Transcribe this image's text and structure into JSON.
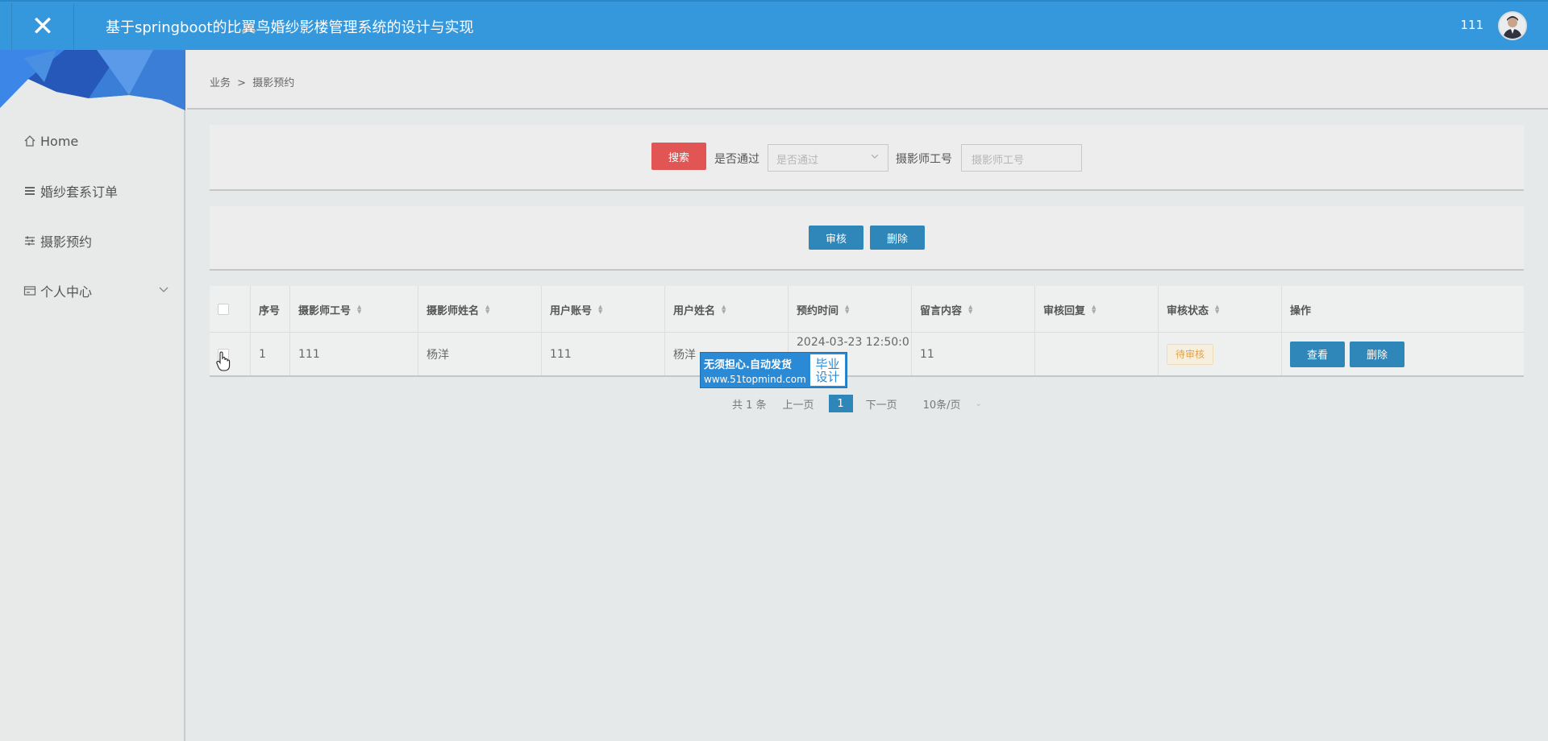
{
  "header": {
    "close_glyph": "✕",
    "title": "基于springboot的比翼鸟婚纱影楼管理系统的设计与实现",
    "username": "111"
  },
  "sidebar": {
    "items": [
      {
        "label": "Home",
        "icon": "home-icon"
      },
      {
        "label": "婚纱套系订单",
        "icon": "list-icon"
      },
      {
        "label": "摄影预约",
        "icon": "sliders-icon"
      },
      {
        "label": "个人中心",
        "icon": "card-icon"
      }
    ]
  },
  "breadcrumb": {
    "parent": "业务",
    "separator": ">",
    "current": "摄影预约"
  },
  "search": {
    "button_label": "搜索",
    "approved_label": "是否通过",
    "approved_placeholder": "是否通过",
    "photographer_id_label": "摄影师工号",
    "photographer_id_placeholder": "摄影师工号"
  },
  "actions": {
    "audit_label": "审核",
    "delete_label": "删除"
  },
  "table": {
    "columns": [
      "序号",
      "摄影师工号",
      "摄影师姓名",
      "用户账号",
      "用户姓名",
      "预约时间",
      "留言内容",
      "审核回复",
      "审核状态",
      "操作"
    ],
    "rows": [
      {
        "index": "1",
        "photographer_id": "111",
        "photographer_name": "杨洋",
        "user_account": "111",
        "user_name": "杨洋",
        "appointment_time": "2024-03-23 12:50:0",
        "message": "11",
        "reply": "",
        "status": "待审核",
        "view_label": "查看",
        "delete_label": "删除"
      }
    ]
  },
  "watermark": {
    "line1": "无须担心.自动发货",
    "line2": "www.51topmind.com",
    "badge_top": "毕业",
    "badge_bottom": "设计"
  },
  "pagination": {
    "total": "共 1 条",
    "prev": "上一页",
    "current": "1",
    "next": "下一页",
    "page_size": "10条/页"
  },
  "colors": {
    "header": "#3598dc",
    "search_button": "#e25555",
    "primary_button": "#2f86b8",
    "pending_badge": "#e0a44a"
  }
}
